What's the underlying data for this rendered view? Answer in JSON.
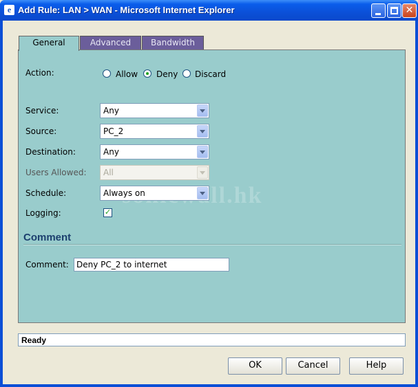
{
  "window": {
    "title": "Add Rule: LAN > WAN - Microsoft Internet Explorer",
    "icon_name": "ie-page-icon",
    "controls": [
      "minimize-icon",
      "maximize-icon",
      "close-icon"
    ]
  },
  "tabs": [
    {
      "label": "General",
      "active": true
    },
    {
      "label": "Advanced",
      "active": false
    },
    {
      "label": "Bandwidth",
      "active": false
    }
  ],
  "form": {
    "action": {
      "label": "Action:",
      "options": [
        "Allow",
        "Deny",
        "Discard"
      ],
      "selected": "Deny"
    },
    "service": {
      "label": "Service:",
      "value": "Any"
    },
    "source": {
      "label": "Source:",
      "value": "PC_2"
    },
    "destination": {
      "label": "Destination:",
      "value": "Any"
    },
    "users_allowed": {
      "label": "Users Allowed:",
      "value": "All",
      "disabled": true
    },
    "schedule": {
      "label": "Schedule:",
      "value": "Always on"
    },
    "logging": {
      "label": "Logging:",
      "checked": true
    }
  },
  "comment_section": {
    "title": "Comment",
    "label": "Comment:",
    "value": "Deny PC_2 to internet"
  },
  "watermark": "sonicwall.hk",
  "status": {
    "text": "Ready"
  },
  "buttons": {
    "ok": "OK",
    "cancel": "Cancel",
    "help": "Help"
  },
  "colors": {
    "panel": "#99CCCC",
    "inactive_tab": "#6B5E9B",
    "titlebar": "#0A5DEB",
    "section_title": "#1C3F6E"
  }
}
